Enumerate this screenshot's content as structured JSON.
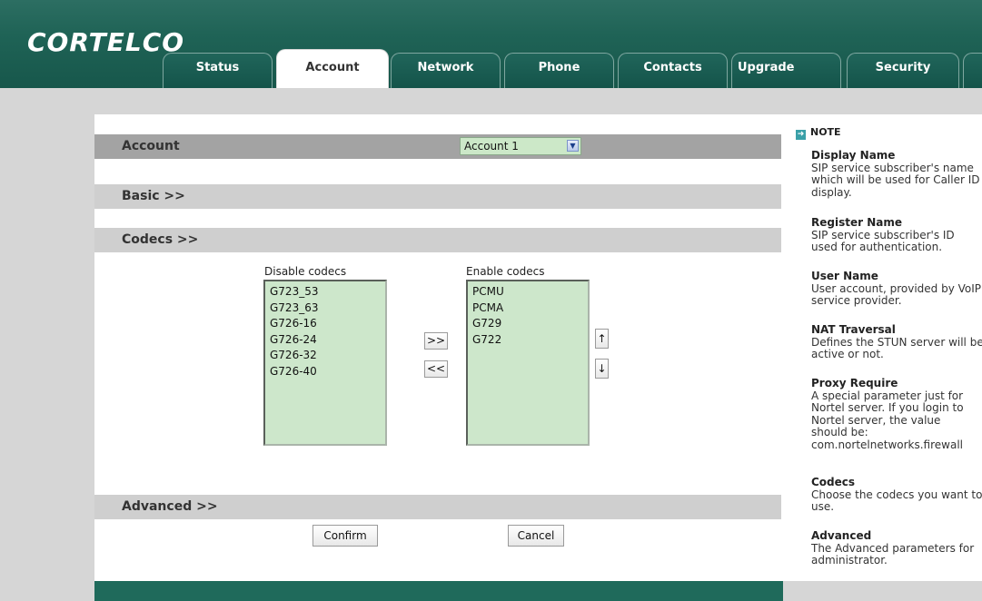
{
  "brand": {
    "logo": "CORTELCO"
  },
  "tabs": [
    {
      "label": "Status",
      "active": false
    },
    {
      "label": "Account",
      "active": true
    },
    {
      "label": "Network",
      "active": false
    },
    {
      "label": "Phone",
      "active": false
    },
    {
      "label": "Contacts",
      "active": false
    },
    {
      "label": "Upgrade",
      "active": false
    },
    {
      "label": "Security",
      "active": false
    }
  ],
  "account": {
    "label": "Account",
    "select_value": "Account 1"
  },
  "sections": {
    "basic": "Basic >>",
    "codecs": "Codecs >>",
    "advanced": "Advanced >>"
  },
  "codecs": {
    "disable_caption": "Disable codecs",
    "enable_caption": "Enable codecs",
    "disabled": [
      "G723_53",
      "G723_63",
      "G726-16",
      "G726-24",
      "G726-32",
      "G726-40"
    ],
    "enabled": [
      "PCMU",
      "PCMA",
      "G729",
      "G722"
    ],
    "move_right": ">>",
    "move_left": "<<",
    "move_up": "↑",
    "move_down": "↓"
  },
  "actions": {
    "confirm": "Confirm",
    "cancel": "Cancel"
  },
  "note": {
    "heading": "NOTE",
    "items": [
      {
        "title": "Display Name",
        "text": "SIP service subscriber's name which will be used for Caller ID display."
      },
      {
        "title": "Register Name",
        "text": "SIP service subscriber's ID used for authentication."
      },
      {
        "title": "User Name",
        "text": "User account, provided by VoIP service provider."
      },
      {
        "title": "NAT Traversal",
        "text": "Defines the STUN server will be active or not."
      },
      {
        "title": "Proxy Require",
        "text": "A special parameter just for Nortel server. If you login to Nortel server, the value should be: com.nortelnetworks.firewall"
      },
      {
        "title": "Codecs",
        "text": "Choose the codecs you want to use."
      },
      {
        "title": "Advanced",
        "text": "The Advanced parameters for administrator."
      }
    ]
  },
  "colors": {
    "header": "#1f6356",
    "list_bg": "#cde7cb",
    "section_bg": "#cfcfcf"
  }
}
